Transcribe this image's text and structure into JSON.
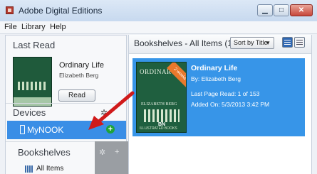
{
  "window": {
    "title": "Adobe Digital Editions",
    "min_glyph": "▁",
    "max_glyph": "□",
    "close_glyph": "✕"
  },
  "menu": [
    "File",
    "Library",
    "Help"
  ],
  "last_read": {
    "heading": "Last Read",
    "title": "Ordinary Life",
    "author": "Elizabeth Berg",
    "button": "Read"
  },
  "devices": {
    "heading": "Devices",
    "gear_glyph": "✲",
    "device_name": "MyNOOK",
    "add_glyph": "+"
  },
  "bookshelves": {
    "heading": "Bookshelves",
    "gear_glyph": "✲",
    "add_glyph": "+",
    "items": [
      "All Items"
    ]
  },
  "library": {
    "heading": "Bookshelves - All Items (1)",
    "sort_label": "Sort by Title",
    "sort_caret": "▼"
  },
  "book": {
    "title": "Ordinary Life",
    "author": "By: Elizabeth Berg",
    "last_page": "Last Page Read: 1 of 153",
    "added": "Added On: 5/3/2013 3:42 PM",
    "cover_title": "ORDINARY",
    "cover_author": "ELIZABETH BERG",
    "cover_logo": "BN",
    "cover_foot": "ILLUSTRATED BOOKS",
    "ribbon_text": "2 weeks"
  },
  "colors": {
    "selection": "#3795e8",
    "arrow": "#d01a1a",
    "add_green": "#1ea33a"
  }
}
